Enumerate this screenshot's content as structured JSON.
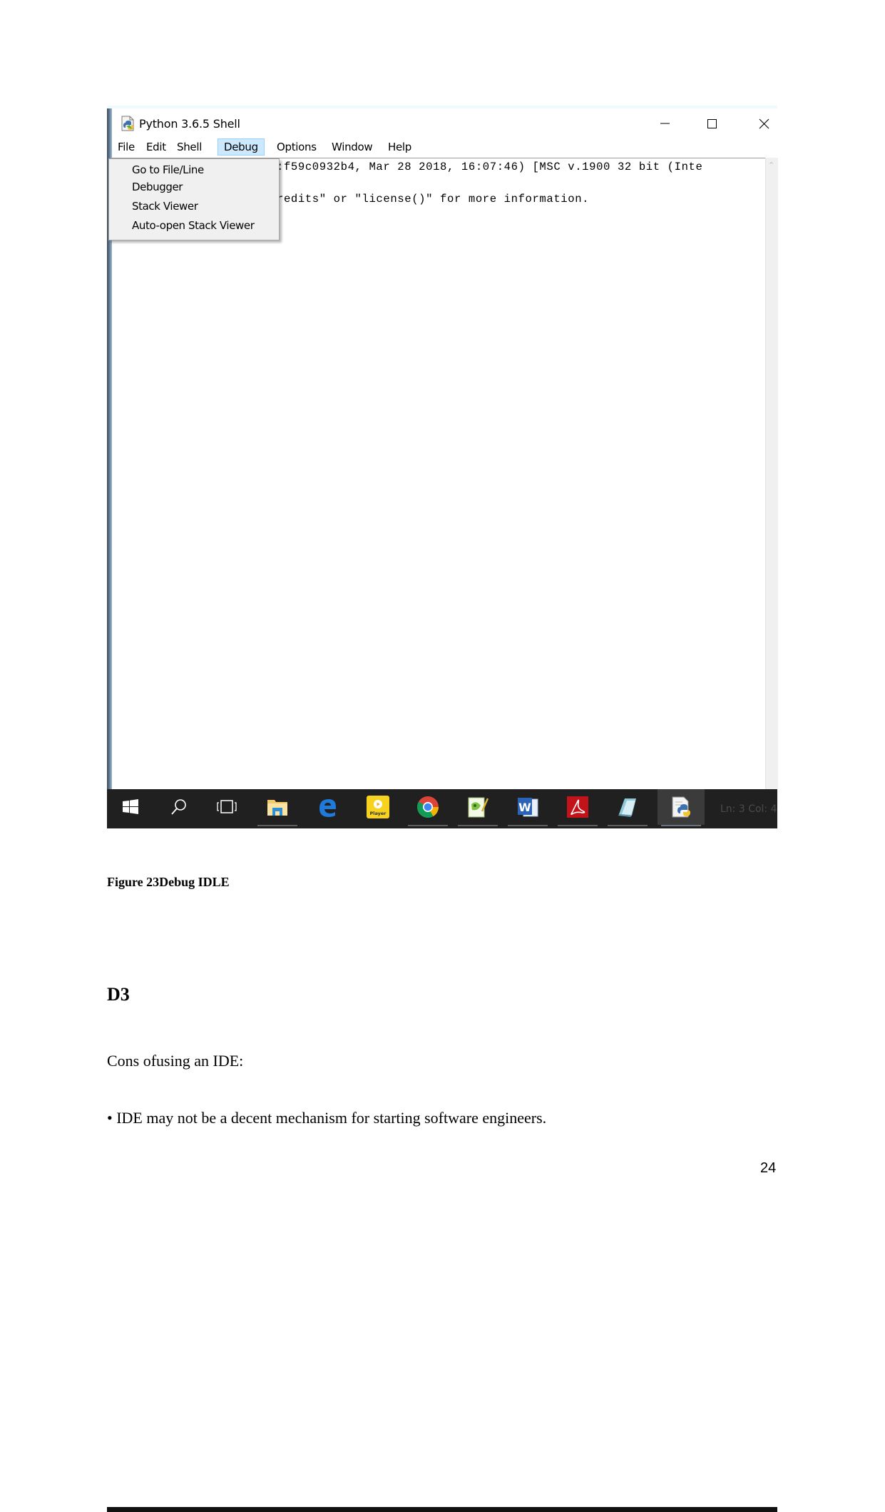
{
  "figure": {
    "window": {
      "title": "Python 3.6.5 Shell",
      "icon": "python-idle-icon",
      "controls": {
        "minimize": "minimize-icon",
        "maximize": "maximize-icon",
        "close": "close-icon"
      }
    },
    "menubar": {
      "items": [
        {
          "label": "File"
        },
        {
          "label": "Edit"
        },
        {
          "label": "Shell"
        },
        {
          "label": "Debug",
          "active": true
        },
        {
          "label": "Options"
        },
        {
          "label": "Window"
        },
        {
          "label": "Help"
        }
      ]
    },
    "debug_menu": {
      "items": [
        {
          "label": "Go to File/Line"
        },
        {
          "label": "Debugger"
        },
        {
          "label": "Stack Viewer"
        },
        {
          "label": "Auto-open Stack Viewer"
        }
      ]
    },
    "shell": {
      "lines": [
        ":f59c0932b4, Mar 28 2018, 16:07:46) [MSC v.1900 32 bit (Inte",
        "redits\" or \"license()\" for more information."
      ]
    },
    "taskbar": {
      "icons": [
        {
          "name": "windows-start-icon"
        },
        {
          "name": "search-icon"
        },
        {
          "name": "task-view-icon"
        },
        {
          "name": "file-explorer-icon"
        },
        {
          "name": "edge-icon"
        },
        {
          "name": "player-icon",
          "label": "Player"
        },
        {
          "name": "chrome-icon"
        },
        {
          "name": "notepad-plus-plus-icon"
        },
        {
          "name": "word-icon",
          "label": "W"
        },
        {
          "name": "acrobat-icon"
        },
        {
          "name": "notepad-icon"
        },
        {
          "name": "python-idle-icon",
          "active": true
        }
      ],
      "status": "Ln: 3   Col: 4"
    }
  },
  "caption": "Figure 23Debug IDLE",
  "heading": "D3",
  "paragraphs": [
    "Cons ofusing an IDE:",
    "• IDE may not be a decent mechanism for starting software engineers."
  ],
  "page_number": "24"
}
